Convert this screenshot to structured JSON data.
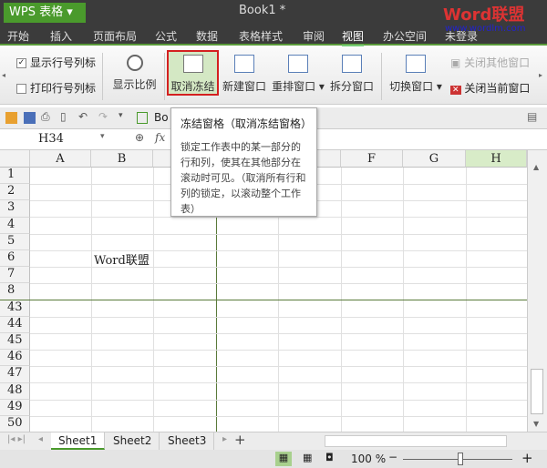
{
  "titlebar": {
    "app": "WPS 表格",
    "doc": "Book1 *",
    "logo": "Word联盟",
    "logo_url": "www.wordlm.com"
  },
  "menu": [
    "开始",
    "插入",
    "页面布局",
    "公式",
    "数据",
    "表格样式",
    "审阅",
    "视图",
    "办公空间",
    "未登录"
  ],
  "ribbon": {
    "show_headers": "显示行号列标",
    "print_headers": "打印行号列标",
    "zoom": "显示比例",
    "unfreeze": "取消冻结",
    "new_window": "新建窗口",
    "arrange": "重排窗口",
    "split": "拆分窗口",
    "switch": "切换窗口",
    "close_others": "关闭其他窗口",
    "close_current": "关闭当前窗口"
  },
  "qtb": {
    "book_tab": "Bo"
  },
  "formula": {
    "namebox": "H34",
    "fx": "fx"
  },
  "tooltip": {
    "title": "冻结窗格（取消冻结窗格）",
    "body": "锁定工作表中的某一部分的行和列，使其在其他部分在滚动时可见。（取消所有行和列的锁定，以滚动整个工作表）"
  },
  "columns": [
    "A",
    "B",
    "C",
    "D",
    "E",
    "F",
    "G",
    "H"
  ],
  "rows": [
    "1",
    "2",
    "3",
    "4",
    "5",
    "6",
    "7",
    "8",
    "43",
    "44",
    "45",
    "46",
    "47",
    "48",
    "49",
    "50"
  ],
  "cell_b6": "Word联盟",
  "sheets": [
    "Sheet1",
    "Sheet2",
    "Sheet3"
  ],
  "status": {
    "zoom": "100 %",
    "zoom_level": 100
  },
  "colors": {
    "accent": "#4a9a2c",
    "highlight": "#d42020"
  }
}
